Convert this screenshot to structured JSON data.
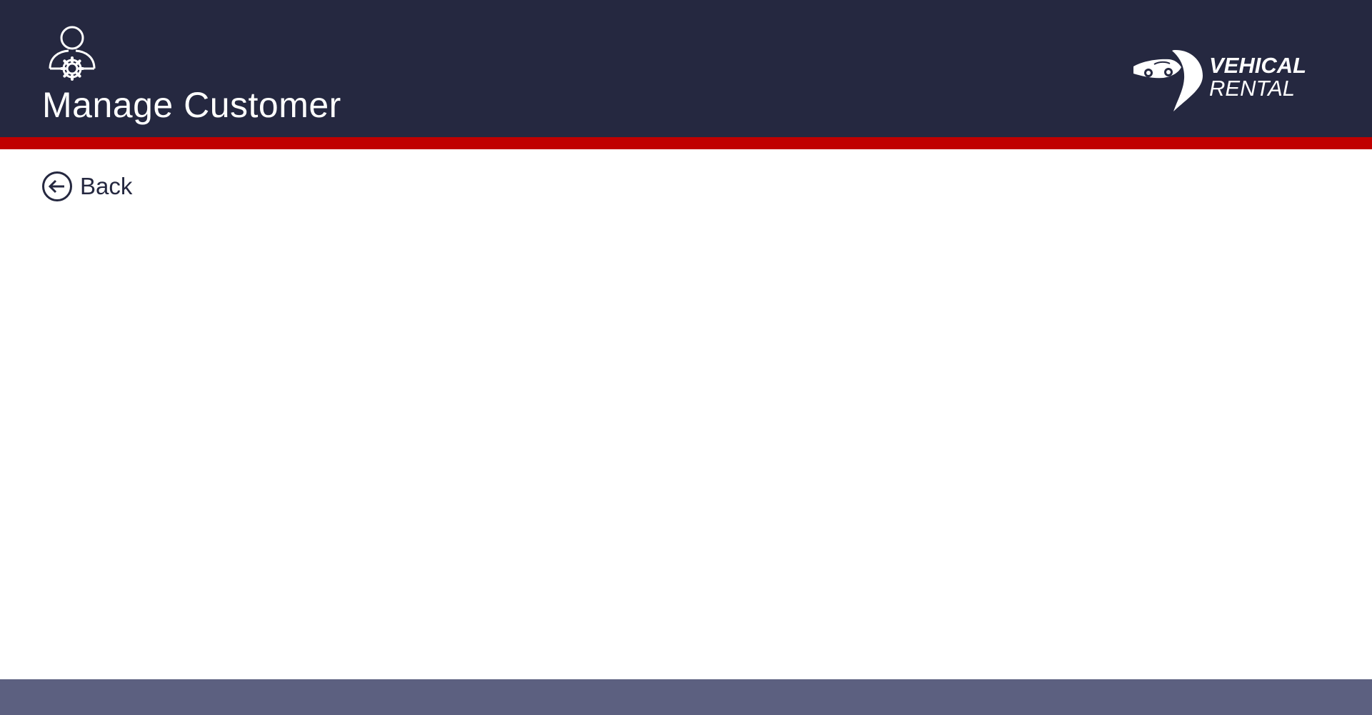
{
  "header": {
    "title": "Manage Customer",
    "page_icon": "user-settings-icon",
    "background_color": "#252840",
    "accent_color": "#c00000"
  },
  "logo": {
    "line1": "VEHICAL",
    "line2": "RENTAL",
    "icon": "car-location-pin-icon"
  },
  "navigation": {
    "back_label": "Back",
    "back_icon": "arrow-left-circle-icon"
  },
  "footer": {
    "background_color": "#5c6080"
  }
}
